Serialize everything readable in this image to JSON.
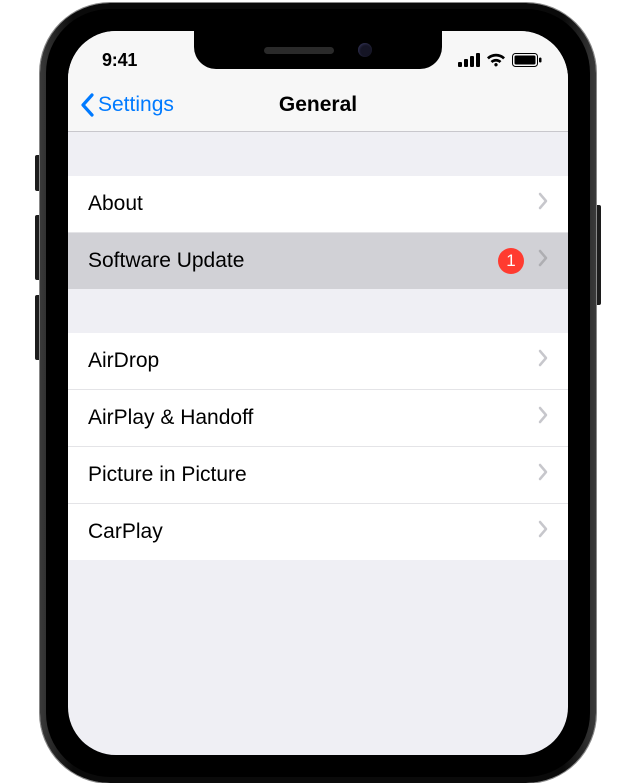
{
  "status": {
    "time": "9:41"
  },
  "nav": {
    "back_label": "Settings",
    "title": "General"
  },
  "sections": [
    {
      "rows": [
        {
          "label": "About",
          "badge": null,
          "selected": false
        },
        {
          "label": "Software Update",
          "badge": "1",
          "selected": true
        }
      ]
    },
    {
      "rows": [
        {
          "label": "AirDrop",
          "badge": null,
          "selected": false
        },
        {
          "label": "AirPlay & Handoff",
          "badge": null,
          "selected": false
        },
        {
          "label": "Picture in Picture",
          "badge": null,
          "selected": false
        },
        {
          "label": "CarPlay",
          "badge": null,
          "selected": false
        }
      ]
    }
  ],
  "colors": {
    "accent": "#007aff",
    "badge": "#ff3b30",
    "section_bg": "#efeff4"
  }
}
